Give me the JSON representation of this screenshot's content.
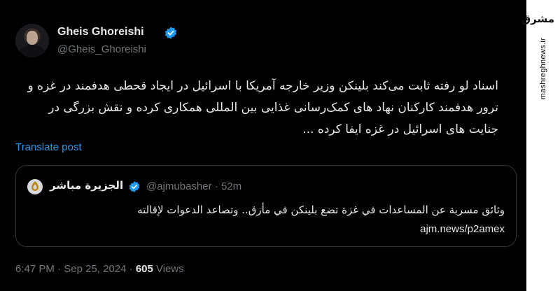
{
  "author": {
    "display_name": "Gheis Ghoreishi",
    "handle": "@Gheis_Ghoreishi"
  },
  "tweet": {
    "text": "اسناد لو رفته ثابت می‌کند بلینکن وزیر خارجه آمریکا با اسرائیل در ایجاد قحطی هدفمند در غزه و ترور هدفمند کارکنان نهاد های کمک‌رسانی غذایی بین المللی همکاری کرده و نقش بزرگی در جنایت های اسرائیل در غزه ایفا کرده ...",
    "translate_label": "Translate post"
  },
  "quote": {
    "name": "الجزيرة مباشر",
    "handle": "@ajmubasher",
    "separator": "·",
    "time": "52m",
    "text": "وثائق مسربة عن المساعدات في غزة تضع بلينكن في مأزق.. وتصاعد الدعوات لإقالته",
    "link": "ajm.news/p2amex"
  },
  "meta": {
    "time": "6:47 PM",
    "separator": "·",
    "date": "Sep 25, 2024",
    "views_count": "605",
    "views_label": "Views"
  },
  "watermark": {
    "logo_text": "مشرق",
    "site": "mashreghnews.ir"
  },
  "colors": {
    "background": "#000000",
    "text": "#e7e9ea",
    "muted": "#71767b",
    "link": "#1d9bf0",
    "verified": "#1d9bf0",
    "border": "#2f3336"
  }
}
